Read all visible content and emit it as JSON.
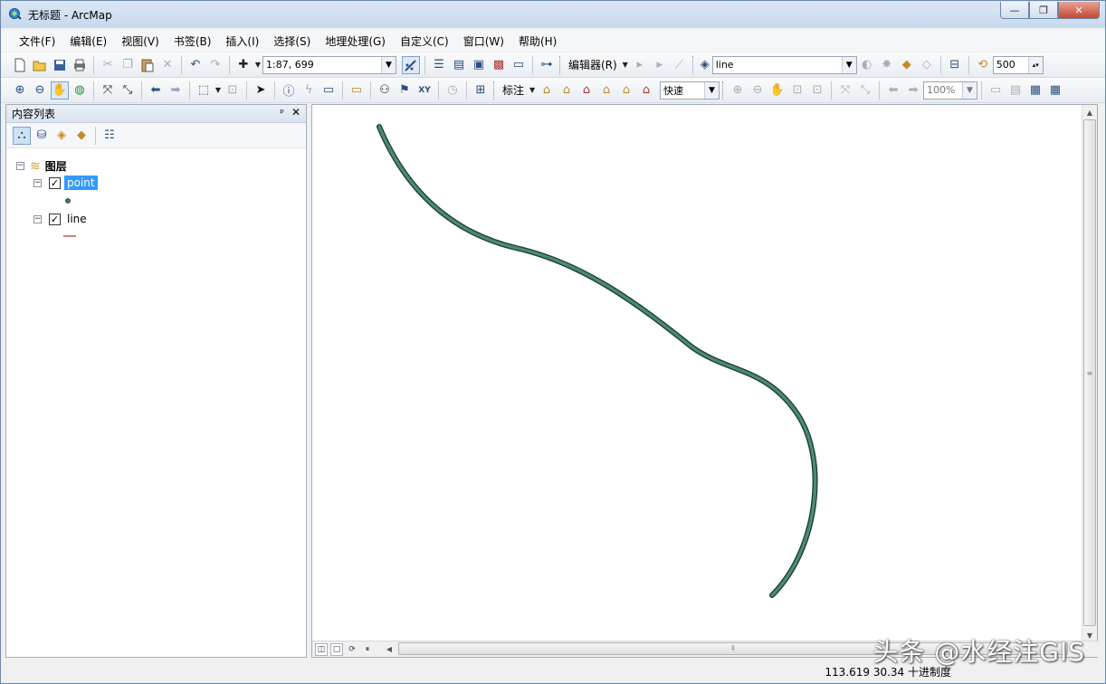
{
  "window": {
    "title": "无标题 - ArcMap",
    "minimize_label": "—",
    "maximize_label": "❐",
    "close_label": "✕"
  },
  "menu": {
    "items": [
      "文件(F)",
      "编辑(E)",
      "视图(V)",
      "书签(B)",
      "插入(I)",
      "选择(S)",
      "地理处理(G)",
      "自定义(C)",
      "窗口(W)",
      "帮助(H)"
    ]
  },
  "toolbar1": {
    "scale_value": "1:87, 699",
    "editor_label": "编辑器(R)",
    "layer_combo_value": "line",
    "number_value": "500"
  },
  "toolbar2": {
    "label_menu": "标注",
    "quality_value": "快速",
    "zoom_percent": "100%"
  },
  "toc": {
    "title": "内容列表",
    "pin": "ᵖ",
    "close": "✕",
    "root_label": "图层",
    "layers": [
      {
        "name": "point",
        "checked": "✓"
      },
      {
        "name": "line",
        "checked": "✓"
      }
    ]
  },
  "status": {
    "coords": "113.619  30.34 十进制度"
  },
  "watermark": "头条 @水经注GIS",
  "colors": {
    "line_stroke": "#2f5f4f",
    "selected_bg": "#3399ff",
    "point_symbol": "#3a7a60",
    "line_symbol": "#a03030"
  }
}
